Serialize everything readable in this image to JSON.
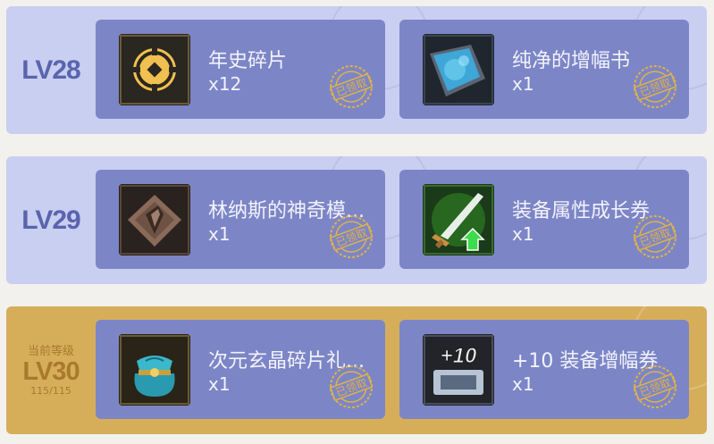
{
  "rows": [
    {
      "level": "LV28",
      "rewards": [
        {
          "name": "年史碎片",
          "qty": "x12",
          "icon": "coin-fragment-icon",
          "stamp": "已领取"
        },
        {
          "name": "纯净的增幅书",
          "qty": "x1",
          "icon": "blue-book-icon",
          "stamp": "已领取"
        }
      ]
    },
    {
      "level": "LV29",
      "rewards": [
        {
          "name": "林纳斯的神奇模...",
          "qty": "x1",
          "icon": "mold-icon",
          "stamp": "已领取"
        },
        {
          "name": "装备属性成长券",
          "qty": "x1",
          "icon": "sword-upgrade-icon",
          "stamp": "已领取"
        }
      ]
    },
    {
      "level": "LV30",
      "current_label": "当前等级",
      "progress": "115/115",
      "rewards": [
        {
          "name": "次元玄晶碎片礼...",
          "qty": "x1",
          "icon": "gift-bag-icon",
          "stamp": "已领取"
        },
        {
          "name": "+10 装备增幅券",
          "qty": "x1",
          "icon": "plus10-ticket-icon",
          "stamp": "已领取"
        }
      ]
    }
  ],
  "colors": {
    "page_bg": "#f3f1ee",
    "row_bg": "#c9cff1",
    "current_row_bg": "#d6ae5a",
    "card_bg": "#7c86c6",
    "level_text": "#5a64ad",
    "current_level_text": "#a9792d",
    "stamp": "#e0b04a"
  }
}
